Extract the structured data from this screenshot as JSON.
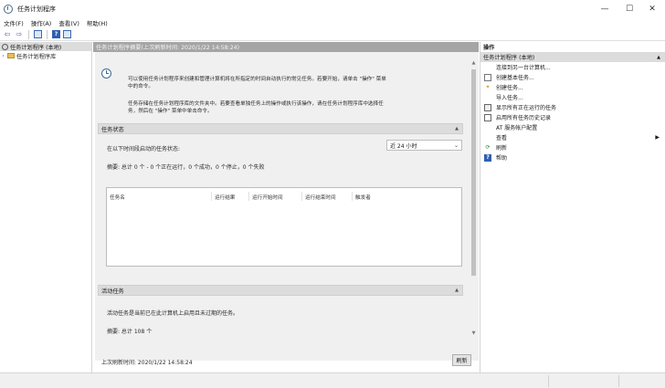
{
  "window": {
    "title": "任务计划程序",
    "minimize": "—",
    "maximize": "☐",
    "close": "✕"
  },
  "menu": [
    "文件(F)",
    "操作(A)",
    "查看(V)",
    "帮助(H)"
  ],
  "toolbar": {
    "back": "⇦",
    "forward": "⇨",
    "help": "?"
  },
  "tree": {
    "root": "任务计划程序 (本地)",
    "child": "任务计划程序库"
  },
  "center": {
    "header": "任务计划程序摘要(上次刷新时间: 2020/1/22 14:58:24)",
    "intro_line1": "可以使用任务计划程序来创建和管理计算机将在所指定的时间自动执行的常见任务。若要开始，请单击 \"操作\" 菜单",
    "intro_line2": "中的命令。",
    "intro_line3": "任务存储在任务计划程序库的文件夹中。若要查看单独任务上的操作或执行该操作，请在任务计划程序库中选择任",
    "intro_line4": "务，然后在 \"操作\" 菜单中单击命令。",
    "status_section": "任务状态",
    "status_prompt": "在以下时间段启动的任务状态:",
    "period": "近 24 小时",
    "summary": "摘要: 总计 0 个 - 0 个正在运行，0 个成功，0 个停止，0 个失败",
    "columns": [
      "任务名",
      "运行结果",
      "运行开始时间",
      "运行结束时间",
      "触发者"
    ],
    "active_section": "活动任务",
    "active_desc": "活动任务是当前已在此计算机上启用且未过期的任务。",
    "active_summary": "摘要: 总计 108 个",
    "last_refresh": "上次刷新时间: 2020/1/22 14:58:24",
    "refresh_btn": "刷新"
  },
  "actions": {
    "title": "操作",
    "group": "任务计划程序 (本地)",
    "items": [
      {
        "label": "连接到另一台计算机...",
        "icon": ""
      },
      {
        "label": "创建基本任务...",
        "icon": "wizard-icon"
      },
      {
        "label": "创建任务...",
        "icon": "new-task-icon"
      },
      {
        "label": "导入任务...",
        "icon": ""
      },
      {
        "label": "显示所有正在运行的任务",
        "icon": "running-tasks-icon"
      },
      {
        "label": "启用所有任务历史记录",
        "icon": "history-icon"
      },
      {
        "label": "AT 服务帐户配置",
        "icon": ""
      },
      {
        "label": "查看",
        "icon": ""
      },
      {
        "label": "刷新",
        "icon": "refresh-icon"
      },
      {
        "label": "帮助",
        "icon": "help-icon"
      }
    ]
  }
}
